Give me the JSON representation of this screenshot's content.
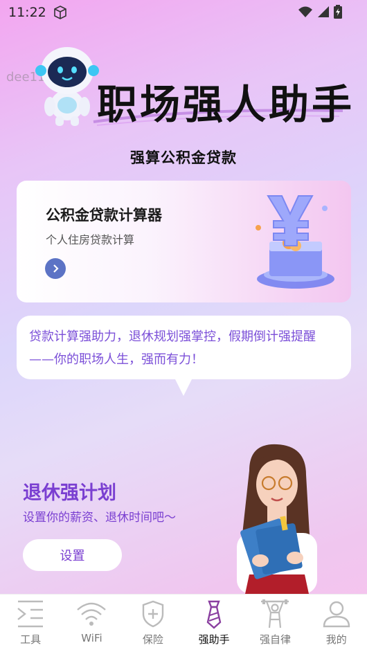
{
  "status_bar": {
    "time": "11:22"
  },
  "watermark": "dee114",
  "hero": {
    "title": "职场强人助手"
  },
  "section_title": "强算公积金贷款",
  "calc_card": {
    "title": "公积金贷款计算器",
    "subtitle": "个人住房贷款计算"
  },
  "bubble": {
    "text": "贷款计算强助力，退休规划强掌控，假期倒计强提醒——你的职场人生，强而有力！"
  },
  "retire": {
    "title": "退休强计划",
    "subtitle": "设置你的薪资、退休时间吧～",
    "button_label": "设置"
  },
  "tabs": [
    {
      "label": "工具",
      "icon": "tools-icon",
      "active": false
    },
    {
      "label": "WiFi",
      "icon": "wifi-icon",
      "active": false
    },
    {
      "label": "保险",
      "icon": "shield-plus-icon",
      "active": false
    },
    {
      "label": "强助手",
      "icon": "tie-icon",
      "active": true
    },
    {
      "label": "强自律",
      "icon": "weightlifter-icon",
      "active": false
    },
    {
      "label": "我的",
      "icon": "person-icon",
      "active": false
    }
  ],
  "colors": {
    "accent_purple": "#7a3fd1",
    "arrow_blue": "#5c73c5",
    "active_icon": "#8a3fa0"
  }
}
